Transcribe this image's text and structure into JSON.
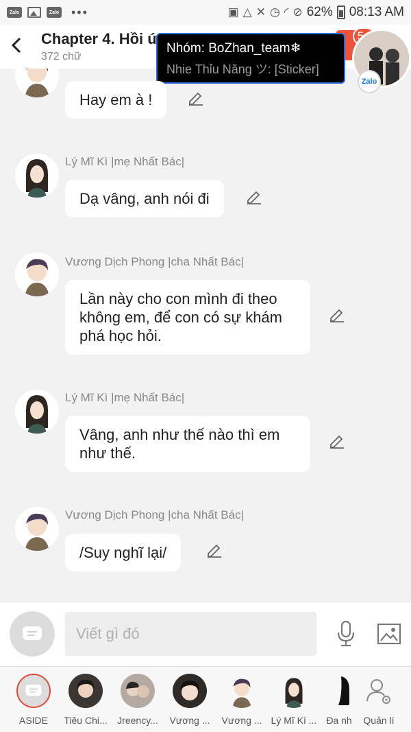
{
  "status_bar": {
    "app_icons": [
      "Zalo",
      "Zalo"
    ],
    "more": "•••",
    "battery": "62%",
    "time": "08:13 AM"
  },
  "header": {
    "title": "Chapter 4. Hồi ú",
    "subtitle": "372 chữ",
    "badge_count": "5+",
    "zalo_label": "Zalo"
  },
  "notification": {
    "title": "Nhóm: BoZhan_team❄",
    "body": "Nhie Thỉu Năng ツ: [Sticker]"
  },
  "messages": [
    {
      "sender": "",
      "text": "Hay em à !",
      "avatar": "male"
    },
    {
      "sender": "Lý Mĩ Kì |mẹ Nhất Bác|",
      "text": "Dạ vâng, anh nói đi",
      "avatar": "female"
    },
    {
      "sender": "Vương Dịch Phong |cha Nhất Bác|",
      "text": "Lần này cho con mình đi theo không em, để con có sự khám phá học hỏi.",
      "avatar": "male"
    },
    {
      "sender": "Lý Mĩ Kì |mẹ Nhất Bác|",
      "text": "Vâng, anh như thế nào thì em như thế.",
      "avatar": "female"
    },
    {
      "sender": "Vương Dịch Phong |cha Nhất Bác|",
      "text": "/Suy nghĩ lại/",
      "avatar": "male"
    }
  ],
  "input": {
    "placeholder": "Viết gì đó"
  },
  "characters": [
    {
      "name": "ASIDE"
    },
    {
      "name": "Tiêu Chi..."
    },
    {
      "name": "Jreency..."
    },
    {
      "name": "Vương ..."
    },
    {
      "name": "Vương ..."
    },
    {
      "name": "Lý Mĩ Kì ..."
    },
    {
      "name": "Đa nh"
    },
    {
      "name": "Quản lí"
    }
  ],
  "colors": {
    "background": "#f2f2f2",
    "bubble": "#ffffff",
    "badge": "#f0533b",
    "notification_border": "#2a6dd6"
  }
}
